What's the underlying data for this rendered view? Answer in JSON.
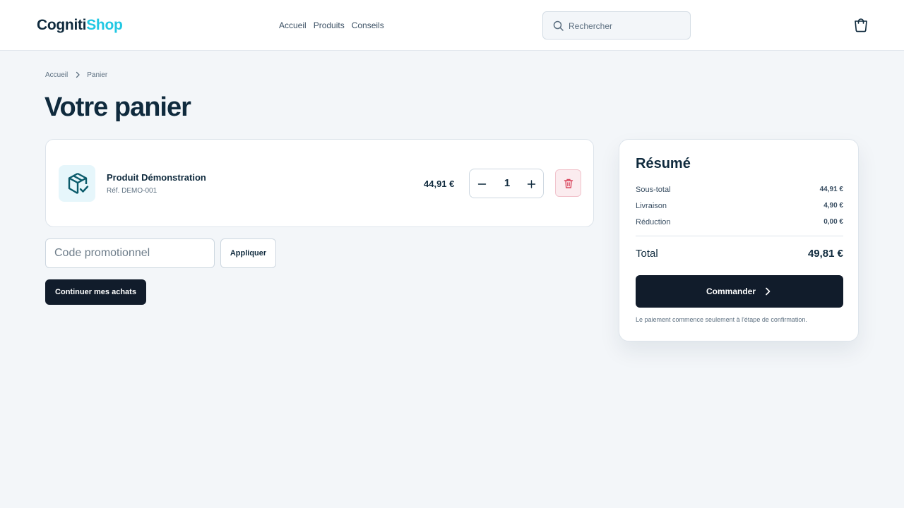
{
  "header": {
    "logo_part1": "Cogniti",
    "logo_part2": "Shop",
    "nav": [
      "Accueil",
      "Produits",
      "Conseils"
    ],
    "search_placeholder": "Rechercher",
    "cart_icon": "shopping-bag-icon"
  },
  "breadcrumb": [
    "Accueil",
    "Panier"
  ],
  "page_title": "Votre panier",
  "cart": {
    "items": [
      {
        "name": "Produit Démonstration",
        "ref": "Réf. DEMO-001",
        "price": "44,91 €",
        "quantity": "1",
        "icon": "package-check-icon"
      }
    ]
  },
  "promo": {
    "placeholder": "Code promotionnel",
    "apply_label": "Appliquer"
  },
  "continue_label": "Continuer mes achats",
  "summary": {
    "title": "Résumé",
    "lines": [
      {
        "label": "Sous-total",
        "value": "44,91 €"
      },
      {
        "label": "Livraison",
        "value": "4,90 €"
      },
      {
        "label": "Réduction",
        "value": "0,00 €"
      }
    ],
    "total_label": "Total",
    "total_value": "49,81 €",
    "order_label": "Commander",
    "note": "Le paiement commence seulement à l'étape de confirmation."
  },
  "colors": {
    "brand_dark": "#0f2a3d",
    "brand_accent": "#22c8e3",
    "button_dark": "#111c2b",
    "delete_red": "#d9485f"
  }
}
